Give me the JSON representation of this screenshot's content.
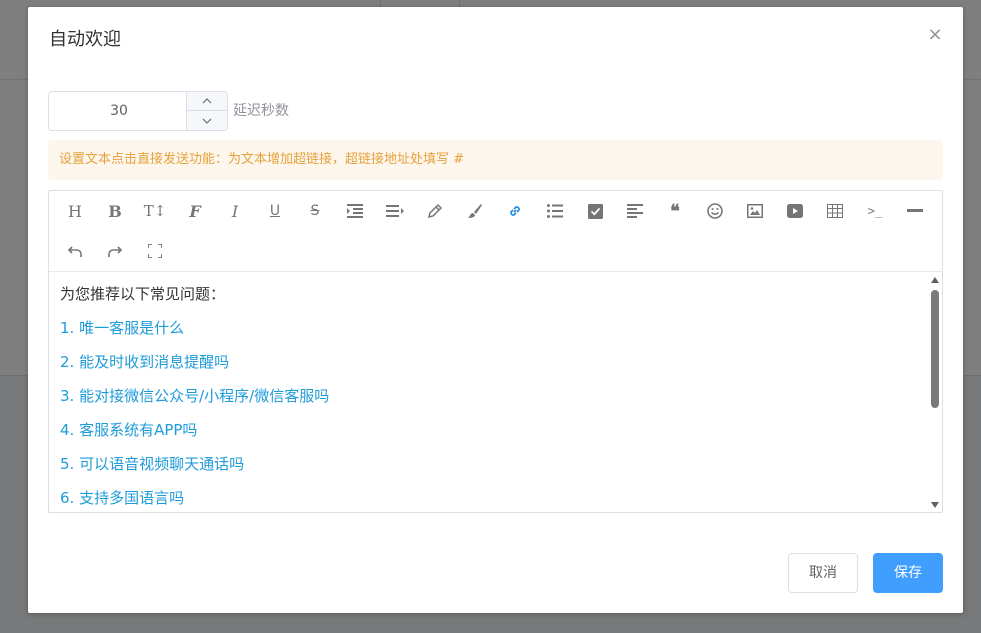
{
  "dialog": {
    "title": "自动欢迎",
    "close_icon": "×"
  },
  "delay": {
    "value": "30",
    "suffix": "延迟秒数"
  },
  "alert": {
    "text": "设置文本点击直接发送功能：为文本增加超链接，超链接地址处填写 #"
  },
  "toolbar": {
    "icons": [
      "heading-icon",
      "bold-icon",
      "text-size-icon",
      "font-icon",
      "italic-icon",
      "underline-icon",
      "strikethrough-icon",
      "indent-icon",
      "align-icon",
      "pencil-icon",
      "brush-icon",
      "link-icon",
      "bullet-list-icon",
      "checkbox-icon",
      "align-left-icon",
      "quote-icon",
      "emoji-icon",
      "image-icon",
      "video-icon",
      "table-icon",
      "code-icon",
      "horizontal-rule-icon",
      "undo-icon",
      "redo-icon",
      "fullscreen-icon"
    ],
    "heading": "H",
    "bold": "B",
    "text_size": "T↕",
    "font": "F",
    "italic": "I",
    "underline": "U",
    "strike": "S",
    "quote": "❝",
    "code": ">_"
  },
  "content": {
    "intro": "为您推荐以下常见问题：",
    "items": [
      "1. 唯一客服是什么",
      "2. 能及时收到消息提醒吗",
      "3. 能对接微信公众号/小程序/微信客服吗",
      "4. 客服系统有APP吗",
      "5. 可以语音视频聊天通话吗",
      "6. 支持多国语言吗"
    ]
  },
  "footer": {
    "cancel_label": "取消",
    "save_label": "保存"
  },
  "colors": {
    "primary": "#409eff",
    "link": "#1e9bd9",
    "warning_text": "#e6a23c",
    "warning_bg": "#fdf6ec"
  }
}
